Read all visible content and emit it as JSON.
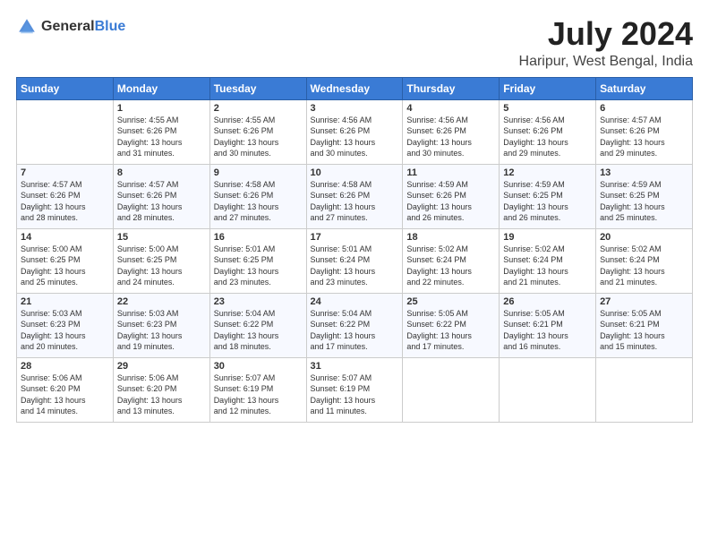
{
  "logo": {
    "general": "General",
    "blue": "Blue"
  },
  "title": "July 2024",
  "subtitle": "Haripur, West Bengal, India",
  "days_header": [
    "Sunday",
    "Monday",
    "Tuesday",
    "Wednesday",
    "Thursday",
    "Friday",
    "Saturday"
  ],
  "weeks": [
    [
      {
        "day": "",
        "info": ""
      },
      {
        "day": "1",
        "info": "Sunrise: 4:55 AM\nSunset: 6:26 PM\nDaylight: 13 hours\nand 31 minutes."
      },
      {
        "day": "2",
        "info": "Sunrise: 4:55 AM\nSunset: 6:26 PM\nDaylight: 13 hours\nand 30 minutes."
      },
      {
        "day": "3",
        "info": "Sunrise: 4:56 AM\nSunset: 6:26 PM\nDaylight: 13 hours\nand 30 minutes."
      },
      {
        "day": "4",
        "info": "Sunrise: 4:56 AM\nSunset: 6:26 PM\nDaylight: 13 hours\nand 30 minutes."
      },
      {
        "day": "5",
        "info": "Sunrise: 4:56 AM\nSunset: 6:26 PM\nDaylight: 13 hours\nand 29 minutes."
      },
      {
        "day": "6",
        "info": "Sunrise: 4:57 AM\nSunset: 6:26 PM\nDaylight: 13 hours\nand 29 minutes."
      }
    ],
    [
      {
        "day": "7",
        "info": "Sunrise: 4:57 AM\nSunset: 6:26 PM\nDaylight: 13 hours\nand 28 minutes."
      },
      {
        "day": "8",
        "info": "Sunrise: 4:57 AM\nSunset: 6:26 PM\nDaylight: 13 hours\nand 28 minutes."
      },
      {
        "day": "9",
        "info": "Sunrise: 4:58 AM\nSunset: 6:26 PM\nDaylight: 13 hours\nand 27 minutes."
      },
      {
        "day": "10",
        "info": "Sunrise: 4:58 AM\nSunset: 6:26 PM\nDaylight: 13 hours\nand 27 minutes."
      },
      {
        "day": "11",
        "info": "Sunrise: 4:59 AM\nSunset: 6:26 PM\nDaylight: 13 hours\nand 26 minutes."
      },
      {
        "day": "12",
        "info": "Sunrise: 4:59 AM\nSunset: 6:25 PM\nDaylight: 13 hours\nand 26 minutes."
      },
      {
        "day": "13",
        "info": "Sunrise: 4:59 AM\nSunset: 6:25 PM\nDaylight: 13 hours\nand 25 minutes."
      }
    ],
    [
      {
        "day": "14",
        "info": "Sunrise: 5:00 AM\nSunset: 6:25 PM\nDaylight: 13 hours\nand 25 minutes."
      },
      {
        "day": "15",
        "info": "Sunrise: 5:00 AM\nSunset: 6:25 PM\nDaylight: 13 hours\nand 24 minutes."
      },
      {
        "day": "16",
        "info": "Sunrise: 5:01 AM\nSunset: 6:25 PM\nDaylight: 13 hours\nand 23 minutes."
      },
      {
        "day": "17",
        "info": "Sunrise: 5:01 AM\nSunset: 6:24 PM\nDaylight: 13 hours\nand 23 minutes."
      },
      {
        "day": "18",
        "info": "Sunrise: 5:02 AM\nSunset: 6:24 PM\nDaylight: 13 hours\nand 22 minutes."
      },
      {
        "day": "19",
        "info": "Sunrise: 5:02 AM\nSunset: 6:24 PM\nDaylight: 13 hours\nand 21 minutes."
      },
      {
        "day": "20",
        "info": "Sunrise: 5:02 AM\nSunset: 6:24 PM\nDaylight: 13 hours\nand 21 minutes."
      }
    ],
    [
      {
        "day": "21",
        "info": "Sunrise: 5:03 AM\nSunset: 6:23 PM\nDaylight: 13 hours\nand 20 minutes."
      },
      {
        "day": "22",
        "info": "Sunrise: 5:03 AM\nSunset: 6:23 PM\nDaylight: 13 hours\nand 19 minutes."
      },
      {
        "day": "23",
        "info": "Sunrise: 5:04 AM\nSunset: 6:22 PM\nDaylight: 13 hours\nand 18 minutes."
      },
      {
        "day": "24",
        "info": "Sunrise: 5:04 AM\nSunset: 6:22 PM\nDaylight: 13 hours\nand 17 minutes."
      },
      {
        "day": "25",
        "info": "Sunrise: 5:05 AM\nSunset: 6:22 PM\nDaylight: 13 hours\nand 17 minutes."
      },
      {
        "day": "26",
        "info": "Sunrise: 5:05 AM\nSunset: 6:21 PM\nDaylight: 13 hours\nand 16 minutes."
      },
      {
        "day": "27",
        "info": "Sunrise: 5:05 AM\nSunset: 6:21 PM\nDaylight: 13 hours\nand 15 minutes."
      }
    ],
    [
      {
        "day": "28",
        "info": "Sunrise: 5:06 AM\nSunset: 6:20 PM\nDaylight: 13 hours\nand 14 minutes."
      },
      {
        "day": "29",
        "info": "Sunrise: 5:06 AM\nSunset: 6:20 PM\nDaylight: 13 hours\nand 13 minutes."
      },
      {
        "day": "30",
        "info": "Sunrise: 5:07 AM\nSunset: 6:19 PM\nDaylight: 13 hours\nand 12 minutes."
      },
      {
        "day": "31",
        "info": "Sunrise: 5:07 AM\nSunset: 6:19 PM\nDaylight: 13 hours\nand 11 minutes."
      },
      {
        "day": "",
        "info": ""
      },
      {
        "day": "",
        "info": ""
      },
      {
        "day": "",
        "info": ""
      }
    ]
  ]
}
